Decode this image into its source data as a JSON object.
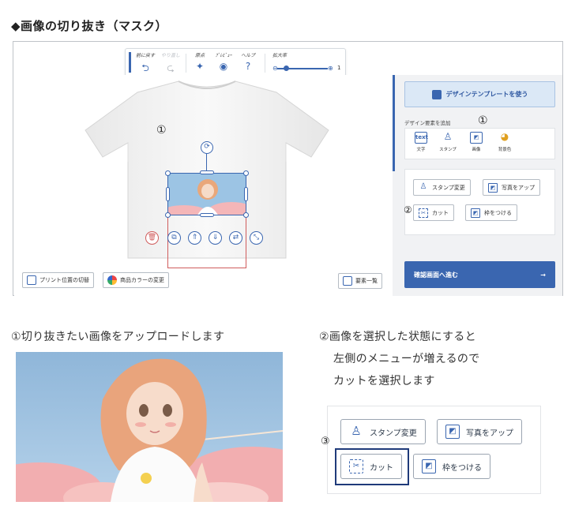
{
  "heading": "◆画像の切り抜き（マスク）",
  "toolbar": {
    "items": [
      {
        "label": "前に戻す",
        "icon": "⮌",
        "enabled": true
      },
      {
        "label": "やり直し",
        "icon": "⮎",
        "enabled": false
      },
      {
        "label": "原点",
        "icon": "✦",
        "enabled": true
      },
      {
        "label": "ﾌﾟﾚﾋﾞｭｰ",
        "icon": "◉",
        "enabled": true
      },
      {
        "label": "ヘルプ",
        "icon": "?",
        "enabled": true
      }
    ],
    "zoom_label": "拡大率",
    "zoom_minus": "⊖",
    "zoom_plus": "⊕",
    "zoom_value": "1"
  },
  "markers": {
    "one": "①",
    "two": "②",
    "three": "③"
  },
  "bottom_buttons": {
    "print_position": "プリント位置の切替",
    "color_change": "商品カラーの変更",
    "element_list": "要素一覧"
  },
  "right_panel": {
    "template_button": "デザインテンプレートを使う",
    "add_label": "デザイン要素を追加",
    "add_items": [
      {
        "icon": "text",
        "label": "文字"
      },
      {
        "icon": "♙",
        "label": "スタンプ"
      },
      {
        "icon": "◩",
        "label": "画像"
      },
      {
        "icon": "◕",
        "label": "背景色"
      }
    ],
    "stamp_change": "スタンプ変更",
    "photo_up": "写真をアップ",
    "cut": "カット",
    "frame": "枠をつける",
    "confirm": "確認画面へ進む",
    "confirm_arrow": "→"
  },
  "steps": {
    "step1": "①切り抜きたい画像をアップロードします",
    "step2_line1": "②画像を選択した状態にすると",
    "step2_line2": "左側のメニューが増えるので",
    "step2_line3": "カットを選択します"
  },
  "zoom_panel": {
    "stamp_change": "スタンプ変更",
    "photo_up": "写真をアップ",
    "cut": "カット",
    "frame": "枠をつける"
  },
  "colors": {
    "accent": "#3a66b0",
    "mask_outline": "#d05c5c",
    "confirm_bg": "#3a66b0",
    "highlight": "#1f3a7a"
  }
}
